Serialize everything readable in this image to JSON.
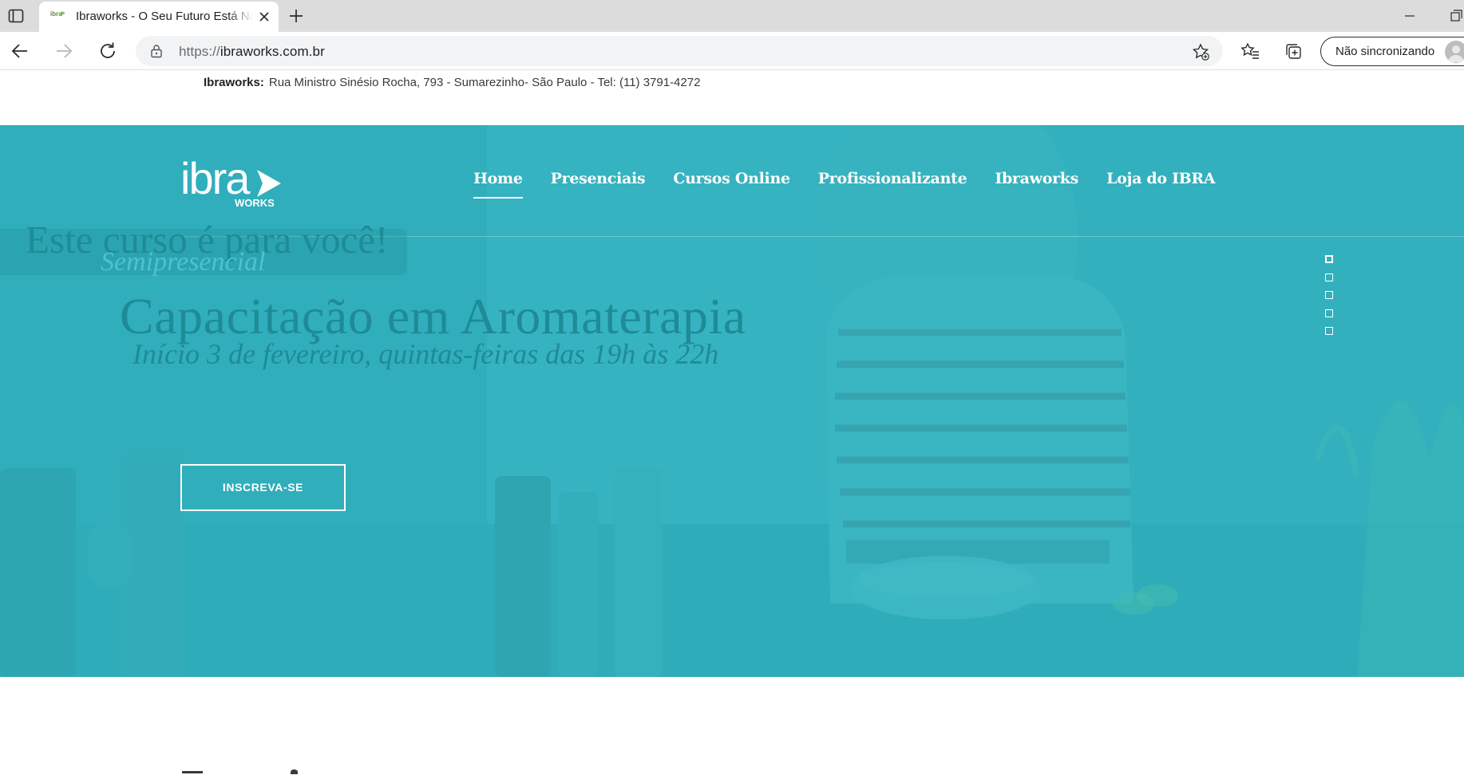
{
  "browser": {
    "tab": {
      "title": "Ibraworks - O Seu Futuro Está Na",
      "favicon_text": "ibra"
    },
    "url": {
      "scheme": "https://",
      "host": "ibraworks.com.br"
    },
    "sync_label": "Não sincronizando"
  },
  "site": {
    "topbar": {
      "brand": "Ibraworks:",
      "contact": "Rua Ministro Sinésio Rocha, 793 - Sumarezinho- São Paulo -  Tel: (11) 3791-4272"
    },
    "logo": {
      "main": "ibra",
      "sub": "WORKS"
    },
    "nav": [
      {
        "label": "Home",
        "active": true
      },
      {
        "label": "Presenciais",
        "active": false
      },
      {
        "label": "Cursos Online",
        "active": false
      },
      {
        "label": "Profissionalizante",
        "active": false
      },
      {
        "label": "Ibraworks",
        "active": false
      },
      {
        "label": "Loja do IBRA",
        "active": false
      }
    ],
    "hero": {
      "kicker": "Este curso é para você!",
      "kicker_sub": "Semipresencial",
      "title": "Capacitação em Aromaterapia",
      "subtitle": "Início 3 de fevereiro, quintas-feiras das 19h às 22h",
      "cta_label": "INSCREVA-SE",
      "overlay_color": "#39b2bf",
      "slides_total": 5,
      "slide_active": 1
    }
  }
}
